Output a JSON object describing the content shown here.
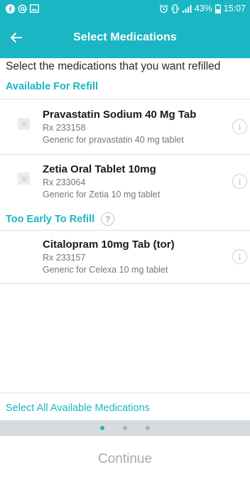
{
  "status_bar": {
    "battery": "43%",
    "time": "15:07"
  },
  "app_bar": {
    "title": "Select Medications"
  },
  "instructions": "Select the medications that you want refilled",
  "sections": {
    "available": {
      "heading": "Available For Refill",
      "items": [
        {
          "name": "Pravastatin Sodium 40 Mg Tab",
          "rx": "Rx 233158",
          "generic": "Generic for pravastatin 40 mg tablet",
          "selected": false
        },
        {
          "name": "Zetia Oral Tablet 10mg",
          "rx": "Rx 233064",
          "generic": "Generic for Zetia 10 mg tablet",
          "selected": false
        }
      ]
    },
    "too_early": {
      "heading": "Too Early To Refill",
      "help_icon": "?",
      "items": [
        {
          "name": "Citalopram 10mg Tab (tor)",
          "rx": "Rx 233157",
          "generic": "Generic for Celexa 10 mg tablet"
        }
      ]
    }
  },
  "info_icon_glyph": "i",
  "select_all_label": "Select All Available Medications",
  "pager": {
    "total": 3,
    "active_index": 0
  },
  "continue_label": "Continue",
  "colors": {
    "accent": "#1bb6c3",
    "pager_bg": "#d6dcde",
    "disabled_text": "#a9a9a9"
  }
}
